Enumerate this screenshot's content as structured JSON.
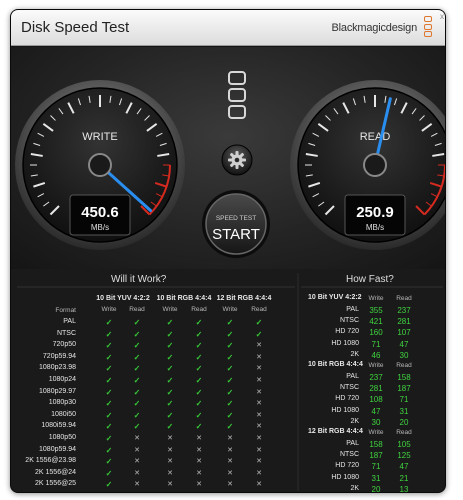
{
  "window": {
    "title": "Disk Speed Test",
    "brand": "Blackmagicdesign",
    "close_glyph": "x"
  },
  "gauges": {
    "write": {
      "label": "WRITE",
      "value": "450.6",
      "unit": "MB/s",
      "needle_fraction": 0.46
    },
    "read": {
      "label": "READ",
      "value": "250.9",
      "unit": "MB/s",
      "needle_fraction": 0.25
    }
  },
  "controls": {
    "settings_icon": "gear-icon",
    "start_small": "SPEED TEST",
    "start_big": "START"
  },
  "will_it_work": {
    "title": "Will it Work?",
    "format_header": "Format",
    "groups": [
      {
        "name": "10 Bit YUV 4:2:2",
        "cols": [
          "Write",
          "Read"
        ]
      },
      {
        "name": "10 Bit RGB 4:4:4",
        "cols": [
          "Write",
          "Read"
        ]
      },
      {
        "name": "12 Bit RGB 4:4:4",
        "cols": [
          "Write",
          "Read"
        ]
      }
    ],
    "rows": [
      {
        "format": "PAL",
        "marks": [
          "✓",
          "✓",
          "✓",
          "✓",
          "✓",
          "✓"
        ]
      },
      {
        "format": "NTSC",
        "marks": [
          "✓",
          "✓",
          "✓",
          "✓",
          "✓",
          "✓"
        ]
      },
      {
        "format": "720p50",
        "marks": [
          "✓",
          "✓",
          "✓",
          "✓",
          "✓",
          "✕"
        ]
      },
      {
        "format": "720p59.94",
        "marks": [
          "✓",
          "✓",
          "✓",
          "✓",
          "✓",
          "✕"
        ]
      },
      {
        "format": "1080p23.98",
        "marks": [
          "✓",
          "✓",
          "✓",
          "✓",
          "✓",
          "✕"
        ]
      },
      {
        "format": "1080p24",
        "marks": [
          "✓",
          "✓",
          "✓",
          "✓",
          "✓",
          "✕"
        ]
      },
      {
        "format": "1080p29.97",
        "marks": [
          "✓",
          "✓",
          "✓",
          "✓",
          "✓",
          "✕"
        ]
      },
      {
        "format": "1080p30",
        "marks": [
          "✓",
          "✓",
          "✓",
          "✓",
          "✓",
          "✕"
        ]
      },
      {
        "format": "1080i50",
        "marks": [
          "✓",
          "✓",
          "✓",
          "✓",
          "✓",
          "✕"
        ]
      },
      {
        "format": "1080i59.94",
        "marks": [
          "✓",
          "✓",
          "✓",
          "✓",
          "✓",
          "✕"
        ]
      },
      {
        "format": "1080p50",
        "marks": [
          "✓",
          "✕",
          "✕",
          "✕",
          "✕",
          "✕"
        ]
      },
      {
        "format": "1080p59.94",
        "marks": [
          "✓",
          "✕",
          "✕",
          "✕",
          "✕",
          "✕"
        ]
      },
      {
        "format": "2K 1556@23.98",
        "marks": [
          "✓",
          "✕",
          "✕",
          "✕",
          "✕",
          "✕"
        ]
      },
      {
        "format": "2K 1556@24",
        "marks": [
          "✓",
          "✕",
          "✕",
          "✕",
          "✕",
          "✕"
        ]
      },
      {
        "format": "2K 1556@25",
        "marks": [
          "✓",
          "✕",
          "✕",
          "✕",
          "✕",
          "✕"
        ]
      }
    ]
  },
  "how_fast": {
    "title": "How Fast?",
    "groups": [
      {
        "name": "10 Bit YUV 4:2:2",
        "cols": [
          "Write",
          "Read"
        ],
        "rows": [
          {
            "format": "PAL",
            "write": "355",
            "read": "237"
          },
          {
            "format": "NTSC",
            "write": "421",
            "read": "281"
          },
          {
            "format": "HD 720",
            "write": "160",
            "read": "107"
          },
          {
            "format": "HD 1080",
            "write": "71",
            "read": "47"
          },
          {
            "format": "2K",
            "write": "46",
            "read": "30"
          }
        ]
      },
      {
        "name": "10 Bit RGB 4:4:4",
        "cols": [
          "Write",
          "Read"
        ],
        "rows": [
          {
            "format": "PAL",
            "write": "237",
            "read": "158"
          },
          {
            "format": "NTSC",
            "write": "281",
            "read": "187"
          },
          {
            "format": "HD 720",
            "write": "108",
            "read": "71"
          },
          {
            "format": "HD 1080",
            "write": "47",
            "read": "31"
          },
          {
            "format": "2K",
            "write": "30",
            "read": "20"
          }
        ]
      },
      {
        "name": "12 Bit RGB 4:4:4",
        "cols": [
          "Write",
          "Read"
        ],
        "rows": [
          {
            "format": "PAL",
            "write": "158",
            "read": "105"
          },
          {
            "format": "NTSC",
            "write": "187",
            "read": "125"
          },
          {
            "format": "HD 720",
            "write": "71",
            "read": "47"
          },
          {
            "format": "HD 1080",
            "write": "31",
            "read": "21"
          },
          {
            "format": "2K",
            "write": "20",
            "read": "13"
          }
        ]
      }
    ]
  },
  "colors": {
    "accent_blue": "#2a8ef0",
    "check_green": "#37c837",
    "value_green": "#3fd43f",
    "redline": "#d42a20"
  }
}
